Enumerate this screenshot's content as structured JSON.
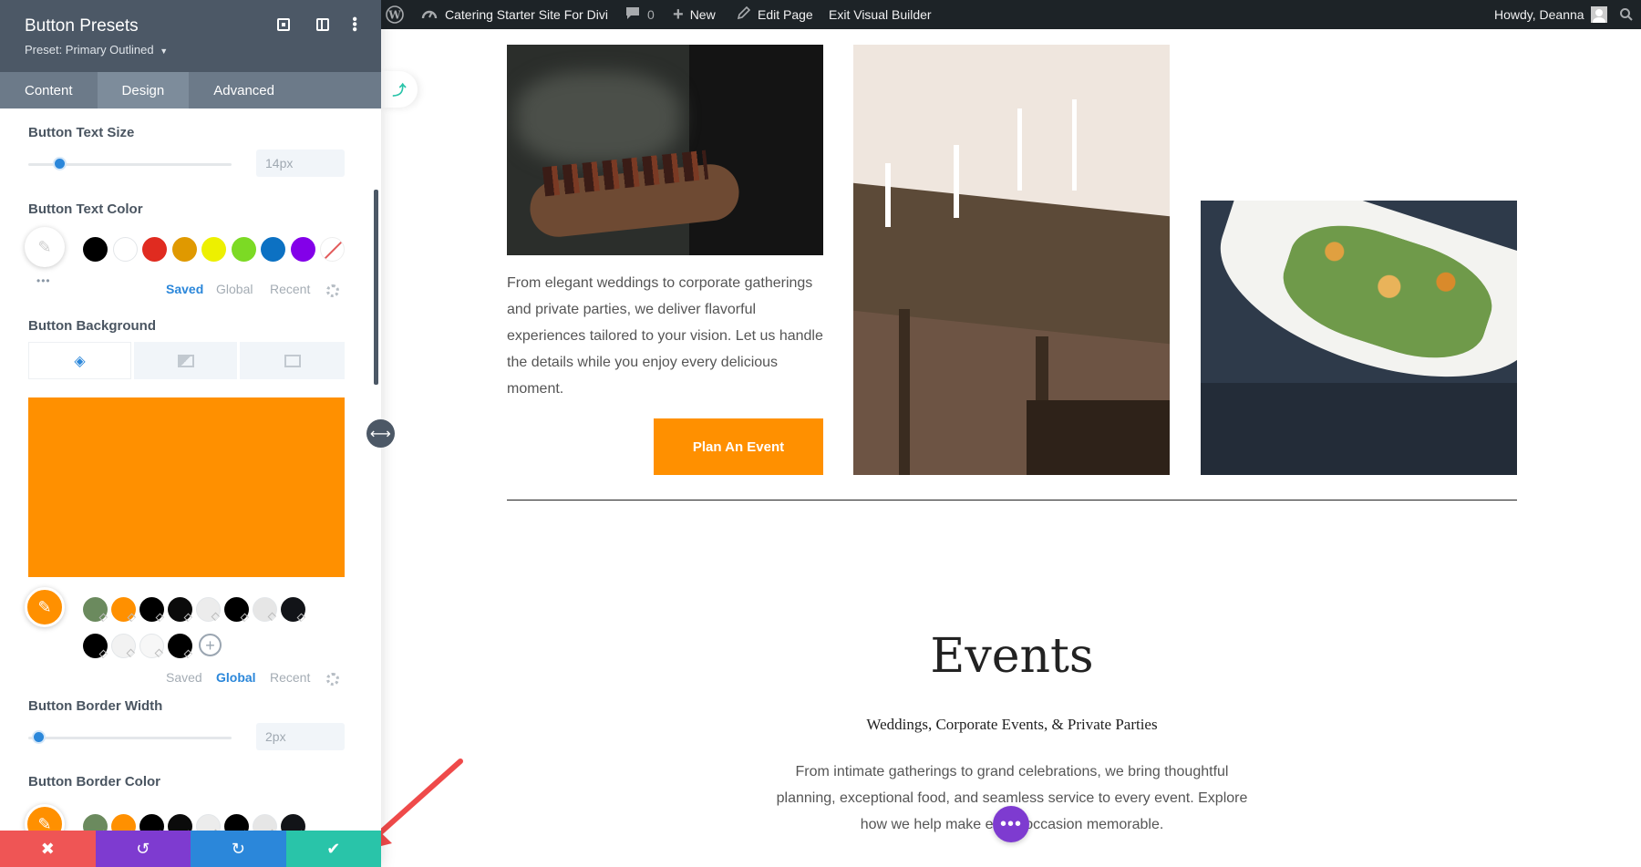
{
  "admin_bar": {
    "site_name": "Catering Starter Site For Divi",
    "comments_count": "0",
    "new_label": "New",
    "edit_page_label": "Edit Page",
    "exit_builder_label": "Exit Visual Builder",
    "greeting": "Howdy, Deanna"
  },
  "panel": {
    "title": "Button Presets",
    "preset": "Preset: Primary Outlined",
    "tabs": [
      {
        "label": "Content"
      },
      {
        "label": "Design"
      },
      {
        "label": "Advanced"
      }
    ],
    "active_tab": "Design",
    "fields": {
      "text_size": {
        "label": "Button Text Size",
        "value": "14px",
        "level": 0.16
      },
      "text_color": {
        "label": "Button Text Color"
      },
      "background": {
        "label": "Button Background",
        "color": "#ff9000"
      },
      "border_width": {
        "label": "Button Border Width",
        "value": "2px",
        "level": 0.02
      },
      "border_color": {
        "label": "Button Border Color"
      }
    },
    "palette_tabs": {
      "saved": "Saved",
      "global": "Global",
      "recent": "Recent"
    },
    "text_color_swatches": [
      "#000000",
      "#ffffff",
      "#e02b20",
      "#e09900",
      "#edf000",
      "#7cda24",
      "#0c71c3",
      "#8300e9"
    ],
    "global_swatches_row1": [
      "#6b8a5e",
      "#ff9000",
      "#000000",
      "#0b0b0b",
      "#ececec",
      "#000000",
      "#e6e6e6",
      "#121418"
    ],
    "global_swatches_row2": [
      "#000000",
      "#f2f2f2",
      "#f7f7f7",
      "#000000"
    ],
    "footer_icons": [
      "close-icon",
      "undo-icon",
      "redo-icon",
      "check-icon"
    ]
  },
  "page": {
    "intro_text": "From elegant weddings to corporate gatherings and private parties, we deliver flavorful experiences tailored to your vision. Let us handle the details while you enjoy every delicious moment.",
    "cta_button": "Plan An Event",
    "events_title": "Events",
    "events_subtitle": "Weddings, Corporate Events, & Private Parties",
    "events_text": "From intimate gatherings to grand celebrations, we bring thoughtful planning, exceptional food, and seamless service to every event. Explore how we help make every occasion memorable.",
    "accent_color": "#ff9000"
  }
}
